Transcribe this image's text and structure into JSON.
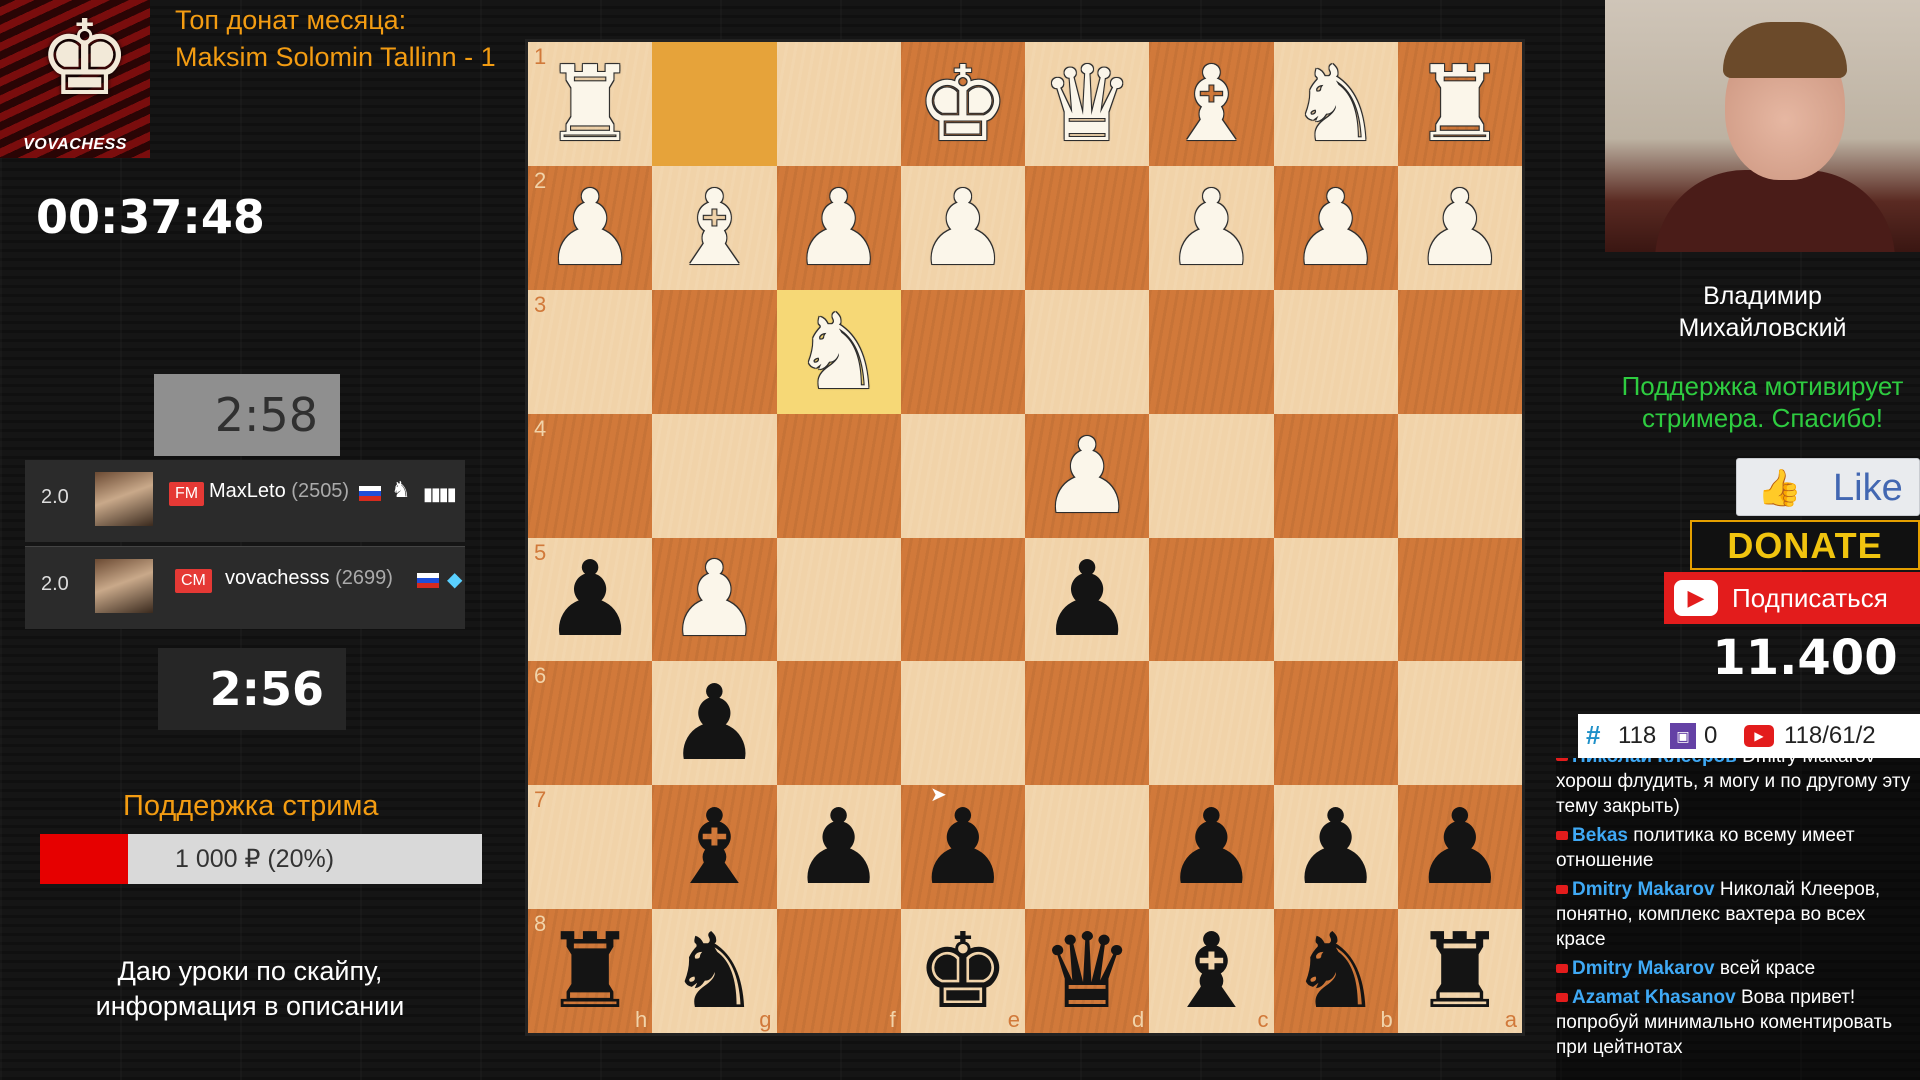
{
  "logo": {
    "text": "VOVACHESS",
    "icon": "king-icon"
  },
  "top_donate": {
    "title": "Топ донат месяца:",
    "value": "Maksim Solomin Tallinn - 1"
  },
  "stream_timer": "00:37:48",
  "clocks": {
    "top": "2:58",
    "bottom": "2:56"
  },
  "players": [
    {
      "score": "2.0",
      "title": "FM",
      "name": "MaxLeto",
      "rating": "(2505)",
      "flag": "russia-flag-icon",
      "extra": "▮▮▮▮"
    },
    {
      "score": "2.0",
      "title": "CM",
      "name": "vovachesss",
      "rating": "(2699)",
      "flag": "russia-flag-icon",
      "extra": "◆"
    }
  ],
  "support": {
    "title": "Поддержка стрима",
    "amount": "1 000 ₽ (20%)",
    "progress": 0.2
  },
  "lessons": {
    "line1": "Даю уроки по скайпу,",
    "line2": "информация в описании"
  },
  "board": {
    "orientation": "black-bottom",
    "rank_labels": [
      "1",
      "2",
      "3",
      "4",
      "5",
      "6",
      "7",
      "8"
    ],
    "file_labels": [
      "h",
      "g",
      "f",
      "e",
      "d",
      "c",
      "b",
      "a"
    ],
    "rows": [
      [
        "wR",
        "",
        "",
        "wK",
        "wQ",
        "wB",
        "wN",
        "wR"
      ],
      [
        "wP",
        "wB",
        "wP",
        "wP",
        "",
        "wP",
        "wP",
        "wP"
      ],
      [
        "",
        "",
        "wN",
        "",
        "",
        "",
        "",
        ""
      ],
      [
        "",
        "",
        "",
        "",
        "wP",
        "",
        "",
        ""
      ],
      [
        "bP",
        "wP",
        "",
        "",
        "bP",
        "",
        "",
        ""
      ],
      [
        "",
        "bP",
        "",
        "",
        "",
        "",
        "",
        ""
      ],
      [
        "",
        "bB",
        "bP",
        "bP",
        "",
        "bP",
        "bP",
        "bP"
      ],
      [
        "bR",
        "bN",
        "",
        "bK",
        "bQ",
        "bB",
        "bN",
        "bR"
      ]
    ],
    "highlights": [
      [
        0,
        1
      ],
      [
        2,
        2
      ]
    ]
  },
  "streamer": {
    "name_line1": "Владимир",
    "name_line2": "Михайловский"
  },
  "support_msg": {
    "line1": "Поддержка мотивирует",
    "line2": "стримера. Спасибо!"
  },
  "buttons": {
    "like": "Like",
    "donate": "DONATE",
    "subscribe": "Подписаться"
  },
  "subs_count": "11.400",
  "stats": {
    "hash": "#",
    "viewers": "118",
    "twitch": "0",
    "youtube": "118/61/2"
  },
  "chat": [
    {
      "user": "Николай Клееров",
      "text": "Dmitry Makarov - хорош флудить, я могу и по другому эту тему закрыть)"
    },
    {
      "user": "Bekas",
      "text": "политика ко всему имеет отношение"
    },
    {
      "user": "Dmitry Makarov",
      "text": "Николай Клееров, понятно, комплекс вахтера во всех красе"
    },
    {
      "user": "Dmitry Makarov",
      "text": "всей красе"
    },
    {
      "user": "Azamat Khasanov",
      "text": "Вова привет! попробуй минимально коментировать при цейтнотах"
    }
  ],
  "colors": {
    "accent_orange": "#f39c12",
    "green_msg": "#2ecc40",
    "board_light": "#f1d3a9",
    "board_dark": "#d1793a"
  }
}
